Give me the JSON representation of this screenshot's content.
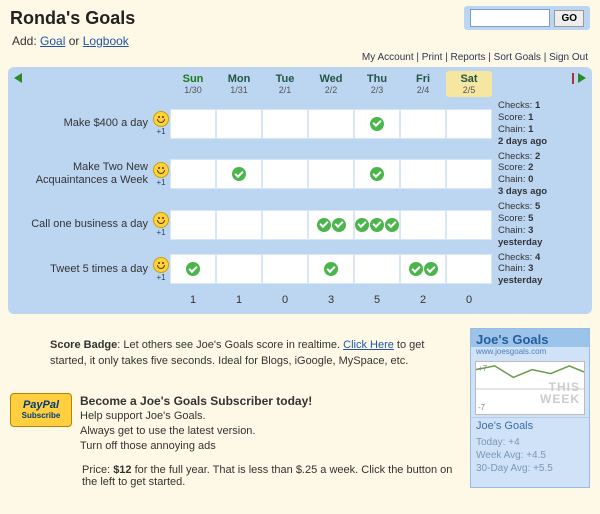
{
  "header": {
    "title": "Ronda's Goals",
    "go_label": "GO",
    "search_value": ""
  },
  "addline": {
    "prefix": "Add:",
    "goal": "Goal",
    "or": "or",
    "logbook": "Logbook"
  },
  "toplinks": [
    "My Account",
    "Print",
    "Reports",
    "Sort Goals",
    "Sign Out"
  ],
  "days": [
    {
      "name": "Sun",
      "date": "1/30",
      "cls": "sun"
    },
    {
      "name": "Mon",
      "date": "1/31",
      "cls": ""
    },
    {
      "name": "Tue",
      "date": "2/1",
      "cls": ""
    },
    {
      "name": "Wed",
      "date": "2/2",
      "cls": ""
    },
    {
      "name": "Thu",
      "date": "2/3",
      "cls": ""
    },
    {
      "name": "Fri",
      "date": "2/4",
      "cls": ""
    },
    {
      "name": "Sat",
      "date": "2/5",
      "cls": "sat"
    }
  ],
  "goals": [
    {
      "label": "Make $400 a day",
      "plus": "+1",
      "checks": [
        0,
        0,
        0,
        0,
        1,
        0,
        0
      ],
      "stats": {
        "checks": "1",
        "score": "1",
        "chain": "1",
        "last": "2 days ago"
      }
    },
    {
      "label": "Make Two New Acquaintances a Week",
      "plus": "+1",
      "checks": [
        0,
        1,
        0,
        0,
        1,
        0,
        0
      ],
      "stats": {
        "checks": "2",
        "score": "2",
        "chain": "0",
        "last": "3 days ago"
      }
    },
    {
      "label": "Call one business a day",
      "plus": "+1",
      "checks": [
        0,
        0,
        0,
        2,
        3,
        0,
        0
      ],
      "stats": {
        "checks": "5",
        "score": "5",
        "chain": "3",
        "last": "yesterday"
      }
    },
    {
      "label": "Tweet 5 times a day",
      "plus": "+1",
      "checks": [
        1,
        0,
        0,
        1,
        0,
        2,
        0
      ],
      "stats": {
        "checks": "4",
        "score": null,
        "chain": "3",
        "last": "yesterday"
      }
    }
  ],
  "totals": [
    "1",
    "1",
    "0",
    "3",
    "5",
    "2",
    "0"
  ],
  "scorebadge": {
    "label": "Score Badge",
    "text1": ": Let others see Joe's Goals score in realtime. ",
    "link": "Click Here",
    "text2": " to get started, it only takes five seconds. Ideal for Blogs, iGoogle, MySpace, etc."
  },
  "subscribe": {
    "headline": "Become a Joe's Goals Subscriber today!",
    "l1": "Help support Joe's Goals.",
    "l2": "Always get to use the latest version.",
    "l3": "Turn off those annoying ads",
    "paypal_top": "PayPal",
    "paypal_bottom": "Subscribe",
    "price_label": "Price:",
    "price_val": "$12",
    "price_rest": " for the full year. That is less than $.25 a week. Click the button on the left to get started."
  },
  "widget": {
    "head": "Joe's Goals",
    "url": "www.joesgoals.com",
    "chart_top": "+7",
    "chart_bottom": "-7",
    "chart_label1": "THIS",
    "chart_label2": "WEEK",
    "title": "Joe's Goals",
    "today": "Today: +4",
    "week": "Week Avg: +4.5",
    "month": "30-Day Avg: +5.5"
  },
  "chart_data": {
    "type": "line",
    "title": "Joe's Goals",
    "xlabel": "",
    "ylabel": "",
    "ylim": [
      -7,
      7
    ],
    "x": [
      0,
      1,
      2,
      3,
      4,
      5,
      6
    ],
    "values": [
      5,
      6,
      3,
      5,
      4,
      6,
      4
    ]
  }
}
